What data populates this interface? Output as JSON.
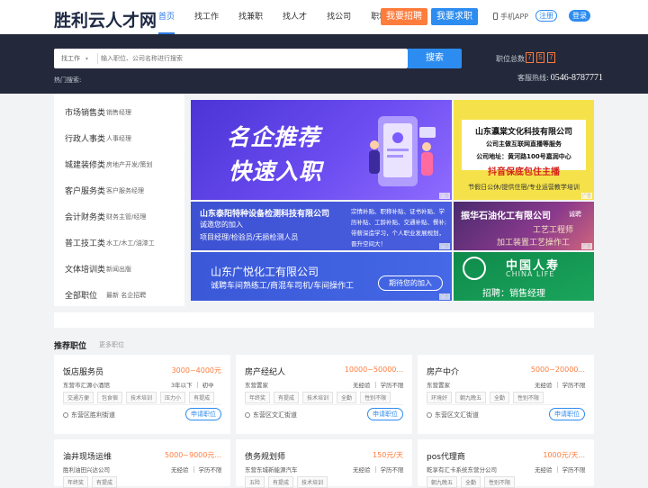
{
  "header": {
    "logo": "胜利云人才网",
    "nav": [
      "首页",
      "找工作",
      "找兼职",
      "找人才",
      "找公司",
      "职场资讯"
    ],
    "btn_recruit": "我要招聘",
    "btn_job": "我要求职",
    "app": "手机APP",
    "register": "注册",
    "login": "登录"
  },
  "search": {
    "type": "找工作",
    "placeholder": "输入职位、公司名称进行搜索",
    "button": "搜索",
    "total_label": "职位总数",
    "total_digits": [
      "7",
      "5",
      "7"
    ],
    "hot_label": "热门搜索:",
    "hotline_label": "客服热线:",
    "hotline_number": "0546-8787771"
  },
  "categories": [
    {
      "main": "市场销售类",
      "sub": "销售经理"
    },
    {
      "main": "行政人事类",
      "sub": "人事经理"
    },
    {
      "main": "城建装修类",
      "sub": "房地产开发/策划"
    },
    {
      "main": "客户服务类",
      "sub": "客户服务经理"
    },
    {
      "main": "会计财务类",
      "sub": "财务主管/经理"
    },
    {
      "main": "普工技工类",
      "sub": "水工/木工/油漆工"
    },
    {
      "main": "文体培训类",
      "sub": "新闻出版"
    },
    {
      "main": "全部职位",
      "sub": "最新  名企招聘"
    }
  ],
  "banners": {
    "b1": {
      "line1": "名企推荐",
      "line2": "快速入职"
    },
    "b2": {
      "line1": "山东瀛棠文化科技有限公司",
      "line2": "公司主做互联网直播等服务",
      "line3": "公司地址：黄河路100号嘉润中心",
      "line4": "抖音保底包住主播",
      "line5": "节假日公休/提供住宿/专业运营教学培训"
    },
    "b3": {
      "line1": "山东泰阳特种设备检测科技有限公司",
      "line2": "诚邀您的加入",
      "line3": "项目经理/检验员/无损检测人员",
      "right": "宗情补贴、职称补贴、证书补贴、学历补贴、工龄补贴、交通补贴、餐补;带薪深造学习，个人职业发展规划，晋升空间大！"
    },
    "b4": {
      "line1": "振华石油化工有限公司",
      "line2": "诚聘",
      "line3": "工艺工程师",
      "line4": "加工装置工艺操作工"
    },
    "b5": {
      "line1": "山东广悦化工有限公司",
      "line2": "诚聘车间熟练工/商混车司机/车间操作工",
      "pill": "期待您的加入"
    },
    "b6": {
      "line1": "中国人寿",
      "line2": "CHINA LIFE",
      "line3": "招聘：销售经理"
    },
    "ad_tag": "广告"
  },
  "section": {
    "title": "推荐职位",
    "more": "更多职位"
  },
  "jobs": [
    {
      "title": "饭店服务员",
      "salary": "3000~4000元",
      "company": "东营市汇源小酒馆",
      "req": [
        "3年以下",
        "初中"
      ],
      "tags": [
        "交通方便",
        "包食宿",
        "技术培训",
        "压力小",
        "有提成"
      ],
      "location": "东营区胜利街道",
      "apply": "申请职位"
    },
    {
      "title": "房产经纪人",
      "salary": "10000~50000...",
      "company": "东营置家",
      "req": [
        "无经验",
        "学历不限"
      ],
      "tags": [
        "年终奖",
        "有提成",
        "技术培训",
        "全勤",
        "性别不限"
      ],
      "location": "东营区文汇街道",
      "apply": "申请职位"
    },
    {
      "title": "房产中介",
      "salary": "5000~20000...",
      "company": "东营置家",
      "req": [
        "无经验",
        "学历不限"
      ],
      "tags": [
        "环境好",
        "朝九晚五",
        "全勤",
        "性别不限"
      ],
      "location": "东营区文汇街道",
      "apply": "申请职位"
    },
    {
      "title": "油井现场运维",
      "salary": "5000~9000元...",
      "company": "胜利油田兴达公司",
      "req": [
        "无经验",
        "学历不限"
      ],
      "tags": [
        "年终奖",
        "有提成"
      ],
      "location": "",
      "apply": ""
    },
    {
      "title": "债务规划师",
      "salary": "150元/天",
      "company": "东营东城新能源汽车",
      "req": [
        "无经验",
        "学历不限"
      ],
      "tags": [
        "五险",
        "有提成",
        "技术培训"
      ],
      "location": "",
      "apply": ""
    },
    {
      "title": "pos代理商",
      "salary": "1000元/天...",
      "company": "乾享有汇卡系统东营分公司",
      "req": [
        "无经验",
        "学历不限"
      ],
      "tags": [
        "朝九晚五",
        "全勤",
        "性别不限"
      ],
      "location": "",
      "apply": ""
    }
  ]
}
